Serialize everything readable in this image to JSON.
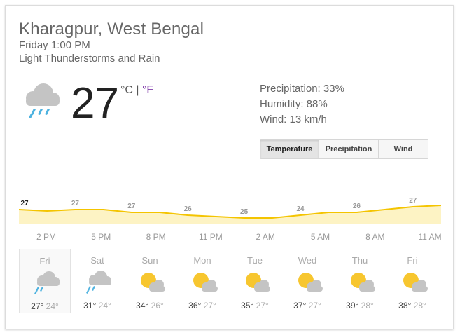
{
  "location": "Kharagpur, West Bengal",
  "datetime": "Friday 1:00 PM",
  "condition": "Light Thunderstorms and Rain",
  "current": {
    "temperature": "27",
    "unit_c": "°C",
    "unit_sep": " | ",
    "unit_f": "°F",
    "icon": "cloud-rain-icon"
  },
  "stats": {
    "precipitation": "Precipitation: 33%",
    "humidity": "Humidity: 88%",
    "wind": "Wind: 13 km/h"
  },
  "tabs": [
    {
      "label": "Temperature",
      "active": true
    },
    {
      "label": "Precipitation",
      "active": false
    },
    {
      "label": "Wind",
      "active": false
    }
  ],
  "colors": {
    "chart_line": "#f4c400",
    "chart_fill": "#fdf3c4",
    "unit_f": "#6a1b9a"
  },
  "chart_data": {
    "type": "area",
    "series": [
      {
        "name": "Temperature",
        "values": [
          27,
          26.5,
          27,
          27,
          26,
          26,
          25,
          24.5,
          24,
          24,
          25,
          26,
          26,
          27,
          28,
          28.5
        ]
      }
    ],
    "point_labels": [
      {
        "index": 0,
        "label": "27"
      },
      {
        "index": 2,
        "label": "27"
      },
      {
        "index": 4,
        "label": "27"
      },
      {
        "index": 6,
        "label": "26"
      },
      {
        "index": 8,
        "label": "25"
      },
      {
        "index": 10,
        "label": "24"
      },
      {
        "index": 12,
        "label": "26"
      },
      {
        "index": 14,
        "label": "27"
      }
    ],
    "x_labels": [
      "2 PM",
      "5 PM",
      "8 PM",
      "11 PM",
      "2 AM",
      "5 AM",
      "8 AM",
      "11 AM"
    ],
    "ylim": [
      22,
      29
    ]
  },
  "forecast": [
    {
      "day": "Fri",
      "high": "27°",
      "low": "24°",
      "icon": "cloud-rain-icon",
      "selected": true
    },
    {
      "day": "Sat",
      "high": "31°",
      "low": "24°",
      "icon": "cloud-rain-icon",
      "selected": false
    },
    {
      "day": "Sun",
      "high": "34°",
      "low": "26°",
      "icon": "partly-sunny-icon",
      "selected": false
    },
    {
      "day": "Mon",
      "high": "36°",
      "low": "27°",
      "icon": "partly-sunny-icon",
      "selected": false
    },
    {
      "day": "Tue",
      "high": "35°",
      "low": "27°",
      "icon": "partly-sunny-icon",
      "selected": false
    },
    {
      "day": "Wed",
      "high": "37°",
      "low": "27°",
      "icon": "partly-sunny-icon",
      "selected": false
    },
    {
      "day": "Thu",
      "high": "39°",
      "low": "28°",
      "icon": "partly-sunny-icon",
      "selected": false
    },
    {
      "day": "Fri",
      "high": "38°",
      "low": "28°",
      "icon": "partly-sunny-icon",
      "selected": false
    }
  ]
}
